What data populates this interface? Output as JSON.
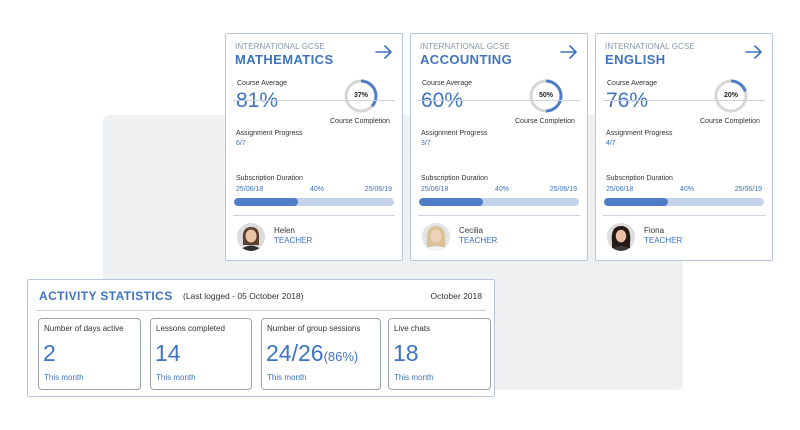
{
  "courses": [
    {
      "program": "INTERNATIONAL GCSE",
      "subject": "MATHEMATICS",
      "course_average_label": "Course Average",
      "course_average": "81%",
      "completion_text": "37%",
      "completion_fraction": 0.37,
      "completion_label": "Course Completion",
      "assignment_label": "Assignment Progress",
      "assignment_value": "6/7",
      "subscription_label": "Subscription Duration",
      "start_date": "25/06/18",
      "duration_percent": "40%",
      "duration_fraction": 0.4,
      "end_date": "25/06/19",
      "teacher_name": "Helen",
      "teacher_role": "TEACHER"
    },
    {
      "program": "INTERNATIONAL GCSE",
      "subject": "ACCOUNTING",
      "course_average_label": "Course Average",
      "course_average": "60%",
      "completion_text": "50%",
      "completion_fraction": 0.5,
      "completion_label": "Course Completion",
      "assignment_label": "Assignment Progress",
      "assignment_value": "3/7",
      "subscription_label": "Subscription Duration",
      "start_date": "25/06/18",
      "duration_percent": "40%",
      "duration_fraction": 0.4,
      "end_date": "25/06/19",
      "teacher_name": "Cecilia",
      "teacher_role": "TEACHER"
    },
    {
      "program": "INTERNATIONAL GCSE",
      "subject": "ENGLISH",
      "course_average_label": "Course Average",
      "course_average": "76%",
      "completion_text": "20%",
      "completion_fraction": 0.2,
      "completion_label": "Course Completion",
      "assignment_label": "Assignment Progress",
      "assignment_value": "4/7",
      "subscription_label": "Subscription Duration",
      "start_date": "25/06/18",
      "duration_percent": "40%",
      "duration_fraction": 0.4,
      "end_date": "25/06/19",
      "teacher_name": "Fiona",
      "teacher_role": "TEACHER"
    }
  ],
  "activity": {
    "title": "ACTIVITY STATISTICS",
    "last_logged": "(Last logged - 05 October 2018)",
    "month": "October 2018",
    "tiles": [
      {
        "label": "Number of days active",
        "value": "2",
        "extra": "",
        "period": "This month"
      },
      {
        "label": "Lessons completed",
        "value": "14",
        "extra": "",
        "period": "This month"
      },
      {
        "label": "Number of group sessions",
        "value": "24/26",
        "extra": "(86%)",
        "period": "This month"
      },
      {
        "label": "Live chats",
        "value": "18",
        "extra": "",
        "period": "This month"
      }
    ]
  },
  "colors": {
    "accent": "#3e73c1",
    "bar_fill": "#4f7ec7",
    "bar_track": "#c5d3ea",
    "ring_track": "#d6d6d6",
    "ring_fill": "#4f7ec7",
    "border": "#b8c6dd"
  },
  "icons": {
    "card_arrow": "arrow-right-icon",
    "avatar": "teacher-avatar"
  }
}
